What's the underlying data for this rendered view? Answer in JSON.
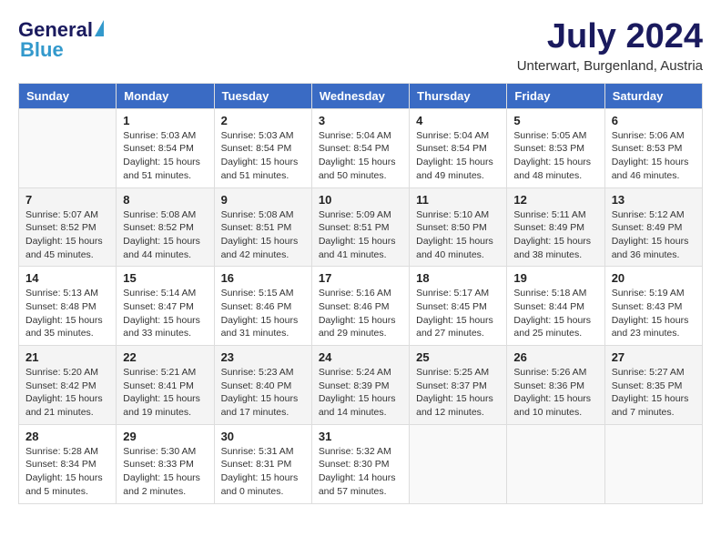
{
  "header": {
    "logo_general": "General",
    "logo_blue": "Blue",
    "month_title": "July 2024",
    "subtitle": "Unterwart, Burgenland, Austria"
  },
  "calendar": {
    "days_of_week": [
      "Sunday",
      "Monday",
      "Tuesday",
      "Wednesday",
      "Thursday",
      "Friday",
      "Saturday"
    ],
    "weeks": [
      [
        {
          "day": "",
          "info": ""
        },
        {
          "day": "1",
          "info": "Sunrise: 5:03 AM\nSunset: 8:54 PM\nDaylight: 15 hours\nand 51 minutes."
        },
        {
          "day": "2",
          "info": "Sunrise: 5:03 AM\nSunset: 8:54 PM\nDaylight: 15 hours\nand 51 minutes."
        },
        {
          "day": "3",
          "info": "Sunrise: 5:04 AM\nSunset: 8:54 PM\nDaylight: 15 hours\nand 50 minutes."
        },
        {
          "day": "4",
          "info": "Sunrise: 5:04 AM\nSunset: 8:54 PM\nDaylight: 15 hours\nand 49 minutes."
        },
        {
          "day": "5",
          "info": "Sunrise: 5:05 AM\nSunset: 8:53 PM\nDaylight: 15 hours\nand 48 minutes."
        },
        {
          "day": "6",
          "info": "Sunrise: 5:06 AM\nSunset: 8:53 PM\nDaylight: 15 hours\nand 46 minutes."
        }
      ],
      [
        {
          "day": "7",
          "info": "Sunrise: 5:07 AM\nSunset: 8:52 PM\nDaylight: 15 hours\nand 45 minutes."
        },
        {
          "day": "8",
          "info": "Sunrise: 5:08 AM\nSunset: 8:52 PM\nDaylight: 15 hours\nand 44 minutes."
        },
        {
          "day": "9",
          "info": "Sunrise: 5:08 AM\nSunset: 8:51 PM\nDaylight: 15 hours\nand 42 minutes."
        },
        {
          "day": "10",
          "info": "Sunrise: 5:09 AM\nSunset: 8:51 PM\nDaylight: 15 hours\nand 41 minutes."
        },
        {
          "day": "11",
          "info": "Sunrise: 5:10 AM\nSunset: 8:50 PM\nDaylight: 15 hours\nand 40 minutes."
        },
        {
          "day": "12",
          "info": "Sunrise: 5:11 AM\nSunset: 8:49 PM\nDaylight: 15 hours\nand 38 minutes."
        },
        {
          "day": "13",
          "info": "Sunrise: 5:12 AM\nSunset: 8:49 PM\nDaylight: 15 hours\nand 36 minutes."
        }
      ],
      [
        {
          "day": "14",
          "info": "Sunrise: 5:13 AM\nSunset: 8:48 PM\nDaylight: 15 hours\nand 35 minutes."
        },
        {
          "day": "15",
          "info": "Sunrise: 5:14 AM\nSunset: 8:47 PM\nDaylight: 15 hours\nand 33 minutes."
        },
        {
          "day": "16",
          "info": "Sunrise: 5:15 AM\nSunset: 8:46 PM\nDaylight: 15 hours\nand 31 minutes."
        },
        {
          "day": "17",
          "info": "Sunrise: 5:16 AM\nSunset: 8:46 PM\nDaylight: 15 hours\nand 29 minutes."
        },
        {
          "day": "18",
          "info": "Sunrise: 5:17 AM\nSunset: 8:45 PM\nDaylight: 15 hours\nand 27 minutes."
        },
        {
          "day": "19",
          "info": "Sunrise: 5:18 AM\nSunset: 8:44 PM\nDaylight: 15 hours\nand 25 minutes."
        },
        {
          "day": "20",
          "info": "Sunrise: 5:19 AM\nSunset: 8:43 PM\nDaylight: 15 hours\nand 23 minutes."
        }
      ],
      [
        {
          "day": "21",
          "info": "Sunrise: 5:20 AM\nSunset: 8:42 PM\nDaylight: 15 hours\nand 21 minutes."
        },
        {
          "day": "22",
          "info": "Sunrise: 5:21 AM\nSunset: 8:41 PM\nDaylight: 15 hours\nand 19 minutes."
        },
        {
          "day": "23",
          "info": "Sunrise: 5:23 AM\nSunset: 8:40 PM\nDaylight: 15 hours\nand 17 minutes."
        },
        {
          "day": "24",
          "info": "Sunrise: 5:24 AM\nSunset: 8:39 PM\nDaylight: 15 hours\nand 14 minutes."
        },
        {
          "day": "25",
          "info": "Sunrise: 5:25 AM\nSunset: 8:37 PM\nDaylight: 15 hours\nand 12 minutes."
        },
        {
          "day": "26",
          "info": "Sunrise: 5:26 AM\nSunset: 8:36 PM\nDaylight: 15 hours\nand 10 minutes."
        },
        {
          "day": "27",
          "info": "Sunrise: 5:27 AM\nSunset: 8:35 PM\nDaylight: 15 hours\nand 7 minutes."
        }
      ],
      [
        {
          "day": "28",
          "info": "Sunrise: 5:28 AM\nSunset: 8:34 PM\nDaylight: 15 hours\nand 5 minutes."
        },
        {
          "day": "29",
          "info": "Sunrise: 5:30 AM\nSunset: 8:33 PM\nDaylight: 15 hours\nand 2 minutes."
        },
        {
          "day": "30",
          "info": "Sunrise: 5:31 AM\nSunset: 8:31 PM\nDaylight: 15 hours\nand 0 minutes."
        },
        {
          "day": "31",
          "info": "Sunrise: 5:32 AM\nSunset: 8:30 PM\nDaylight: 14 hours\nand 57 minutes."
        },
        {
          "day": "",
          "info": ""
        },
        {
          "day": "",
          "info": ""
        },
        {
          "day": "",
          "info": ""
        }
      ]
    ]
  }
}
